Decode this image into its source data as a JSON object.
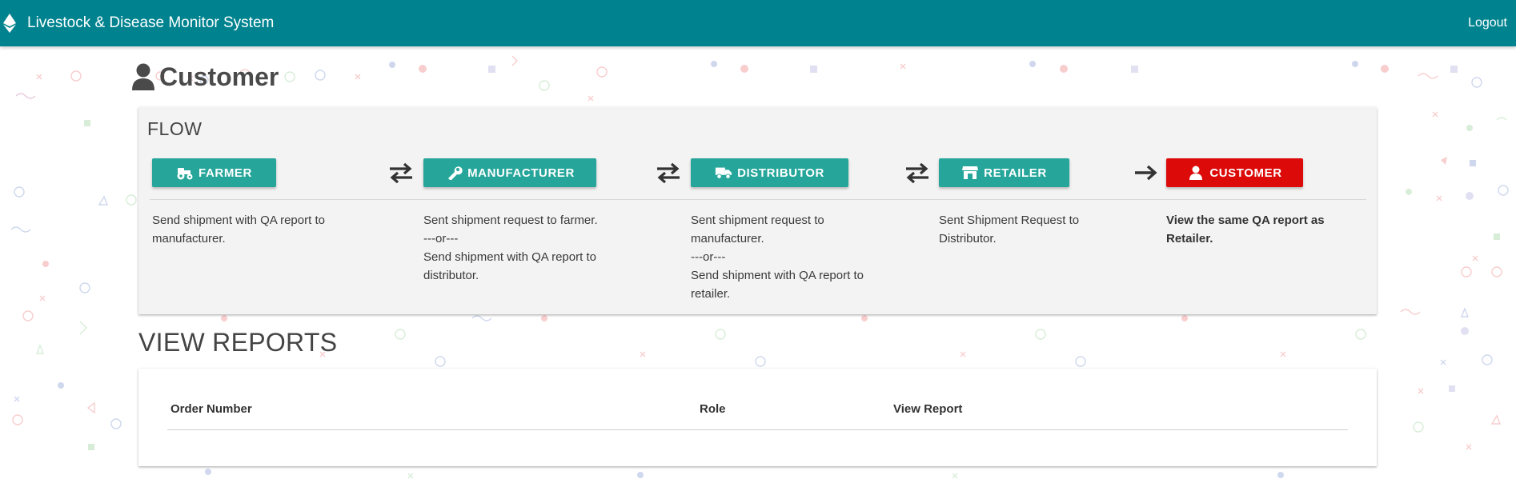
{
  "app": {
    "title": "Livestock & Disease Monitor System",
    "logout_label": "Logout"
  },
  "page": {
    "title": "Customer",
    "icon": "user-icon"
  },
  "flow": {
    "title": "FLOW",
    "steps": [
      {
        "label": "FARMER",
        "icon": "tractor-icon",
        "color": "#26a69a",
        "description": [
          "Send shipment with QA report to",
          "manufacturer."
        ]
      },
      {
        "label": "MANUFACTURER",
        "icon": "wrench-icon",
        "color": "#26a69a",
        "description": [
          "Sent shipment request to farmer.",
          "---or---",
          "Send shipment with QA report to",
          "distributor."
        ]
      },
      {
        "label": "DISTRIBUTOR",
        "icon": "truck-icon",
        "color": "#26a69a",
        "description": [
          "Sent shipment request to",
          "manufacturer.",
          "---or---",
          "Send shipment with QA report to",
          "retailer."
        ]
      },
      {
        "label": "RETAILER",
        "icon": "store-icon",
        "color": "#26a69a",
        "description": [
          "Sent Shipment Request to",
          "Distributor."
        ]
      },
      {
        "label": "CUSTOMER",
        "icon": "user-icon",
        "color": "#dd0a0a",
        "description": [
          "View the same QA report as",
          "Retailer."
        ]
      }
    ],
    "arrows": [
      "exchange-arrows-icon",
      "exchange-arrows-icon",
      "exchange-arrows-icon",
      "right-arrow-icon"
    ]
  },
  "reports": {
    "title": "VIEW REPORTS",
    "columns": [
      "Order Number",
      "Role",
      "View Report"
    ],
    "rows": []
  },
  "colors": {
    "navbar": "#00838f",
    "accent_teal": "#26a69a",
    "accent_red": "#dd0a0a"
  }
}
